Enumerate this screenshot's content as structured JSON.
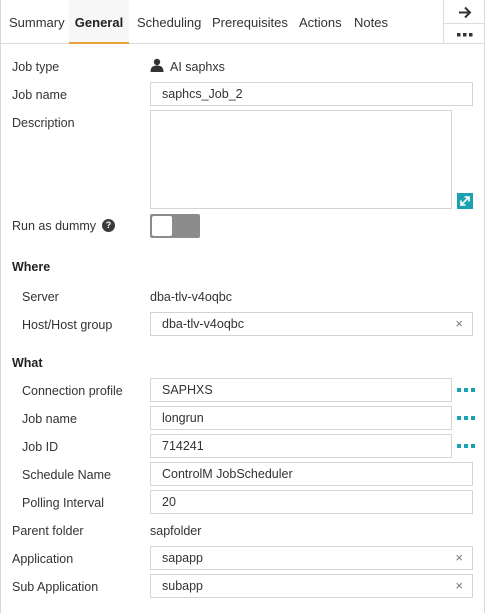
{
  "tabs": [
    "Summary",
    "General",
    "Scheduling",
    "Prerequisites",
    "Actions",
    "Notes"
  ],
  "active_tab": "General",
  "form": {
    "job_type": {
      "label": "Job type",
      "value": "AI saphxs"
    },
    "job_name": {
      "label": "Job name",
      "value": "saphcs_Job_2"
    },
    "description": {
      "label": "Description",
      "value": ""
    },
    "run_as_dummy": {
      "label": "Run as dummy",
      "help": "?",
      "on": false
    }
  },
  "where": {
    "title": "Where",
    "server": {
      "label": "Server",
      "value": "dba-tlv-v4oqbc"
    },
    "host_group": {
      "label": "Host/Host group",
      "value": "dba-tlv-v4oqbc",
      "clear": "×"
    }
  },
  "what": {
    "title": "What",
    "connection_profile": {
      "label": "Connection profile",
      "value": "SAPHXS"
    },
    "job_name": {
      "label": "Job name",
      "value": "longrun"
    },
    "job_id": {
      "label": "Job ID",
      "value": "714241"
    },
    "schedule_name": {
      "label": "Schedule Name",
      "value": "ControlM JobScheduler"
    },
    "polling_interval": {
      "label": "Polling Interval",
      "value": "20"
    }
  },
  "parent_folder": {
    "label": "Parent folder",
    "value": "sapfolder"
  },
  "application": {
    "label": "Application",
    "value": "sapapp",
    "clear": "×"
  },
  "sub_application": {
    "label": "Sub Application",
    "value": "subapp",
    "clear": "×"
  },
  "colors": {
    "accent": "#1aa2b0",
    "active_tab_underline": "#e8a23a",
    "toggle_off": "#8c8c8c"
  },
  "icons": {
    "user": "user-icon",
    "arrow": "arrow-right-icon",
    "more": "more-dots-icon",
    "expand": "expand-icon"
  }
}
